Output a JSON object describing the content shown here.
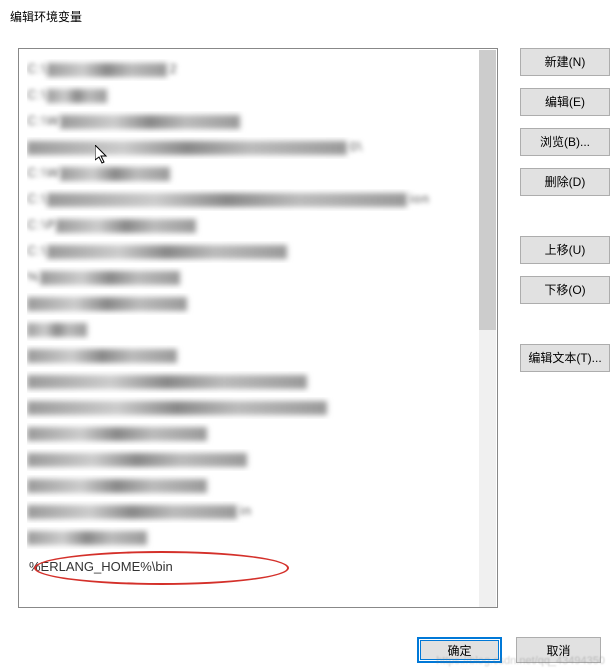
{
  "window": {
    "title": "编辑环境变量"
  },
  "list": {
    "highlighted_entry": "%ERLANG_HOME%\\bin",
    "blurred_rows": [
      {
        "prefix": "C:\\",
        "w1": 120,
        "suffix": "2"
      },
      {
        "prefix": "C:\\",
        "w1": 60,
        "suffix": ""
      },
      {
        "prefix": "C:\\W",
        "w1": 180,
        "suffix": ""
      },
      {
        "prefix": "",
        "w1": 320,
        "suffix": "0\\"
      },
      {
        "prefix": "C:\\W",
        "w1": 110,
        "suffix": ""
      },
      {
        "prefix": "C:\\",
        "w1": 360,
        "suffix": "ion"
      },
      {
        "prefix": "C:\\P",
        "w1": 140,
        "suffix": ""
      },
      {
        "prefix": "C:\\",
        "w1": 240,
        "suffix": ""
      },
      {
        "prefix": "%",
        "w1": 140,
        "suffix": ""
      },
      {
        "prefix": "",
        "w1": 160,
        "suffix": ""
      },
      {
        "prefix": "",
        "w1": 60,
        "suffix": ""
      },
      {
        "prefix": "",
        "w1": 150,
        "suffix": ""
      },
      {
        "prefix": "",
        "w1": 280,
        "suffix": ""
      },
      {
        "prefix": "",
        "w1": 300,
        "suffix": ""
      },
      {
        "prefix": "",
        "w1": 180,
        "suffix": ""
      },
      {
        "prefix": "",
        "w1": 220,
        "suffix": ""
      },
      {
        "prefix": "",
        "w1": 180,
        "suffix": ""
      },
      {
        "prefix": "",
        "w1": 210,
        "suffix": "in"
      },
      {
        "prefix": "",
        "w1": 120,
        "suffix": ""
      }
    ]
  },
  "buttons": {
    "new": "新建(N)",
    "edit": "编辑(E)",
    "browse": "浏览(B)...",
    "delete": "删除(D)",
    "move_up": "上移(U)",
    "move_down": "下移(O)",
    "edit_text": "编辑文本(T)..."
  },
  "bottom": {
    "ok": "确定",
    "cancel": "取消"
  },
  "watermark": "https://blog.csdn.net/qq_43494350"
}
